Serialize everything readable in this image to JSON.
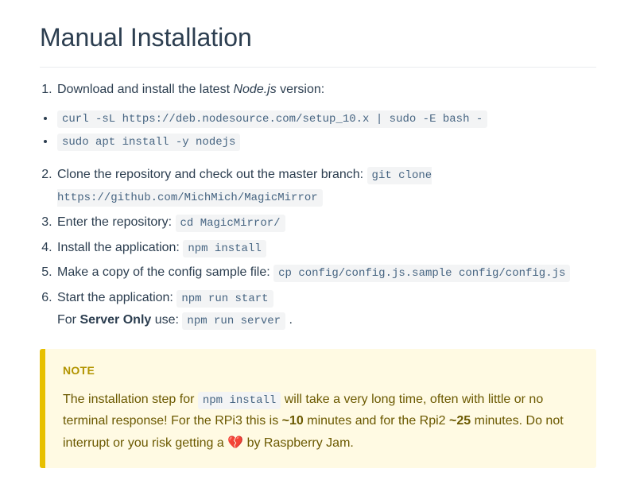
{
  "heading": "Manual Installation",
  "step1": {
    "pre": "Download and install the latest ",
    "em": "Node.js",
    "post": " version:"
  },
  "bullets": {
    "cmd1": "curl -sL https://deb.nodesource.com/setup_10.x | sudo -E bash -",
    "cmd2": "sudo apt install -y nodejs"
  },
  "step2": {
    "text": "Clone the repository and check out the master branch: ",
    "code": "git clone https://github.com/MichMich/MagicMirror"
  },
  "step3": {
    "text": "Enter the repository: ",
    "code": "cd MagicMirror/"
  },
  "step4": {
    "text": "Install the application: ",
    "code": "npm install"
  },
  "step5": {
    "text": "Make a copy of the config sample file: ",
    "code": "cp config/config.js.sample config/config.js"
  },
  "step6": {
    "text": "Start the application: ",
    "code": "npm run start",
    "line2_pre": "For ",
    "line2_strong": "Server Only",
    "line2_mid": " use: ",
    "line2_code": "npm run server",
    "line2_end": " ."
  },
  "note": {
    "title": "NOTE",
    "p1": "The installation step for ",
    "p1_code": "npm install",
    "p2": " will take a very long time, often with little or no terminal response! For the RPi3 this is ",
    "p2_b1": "~10",
    "p3": " minutes and for the Rpi2 ",
    "p3_b1": "~25",
    "p4": " minutes. Do not interrupt or you risk getting a ",
    "heart": "💔",
    "p5": " by Raspberry Jam."
  }
}
